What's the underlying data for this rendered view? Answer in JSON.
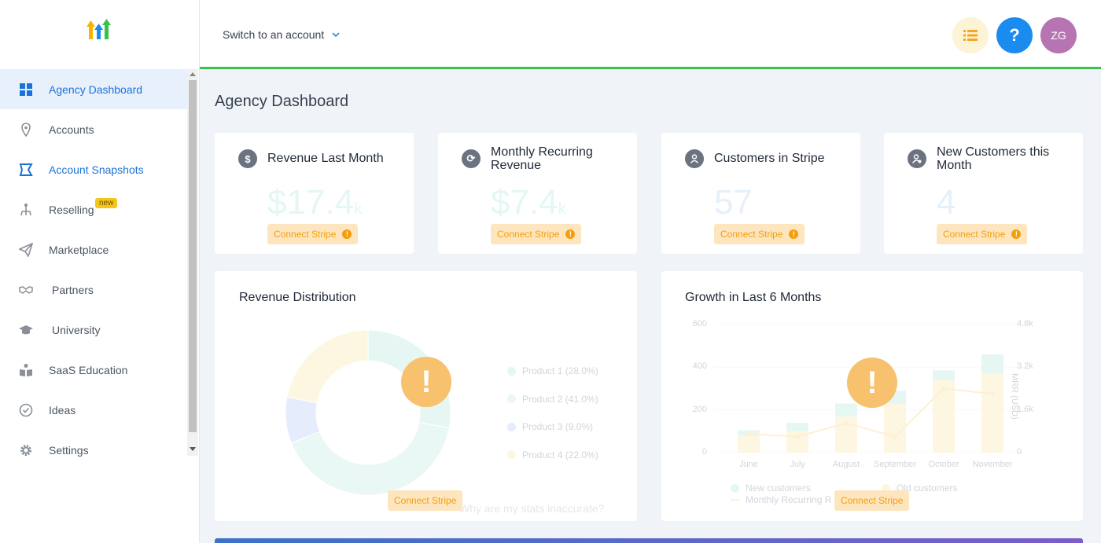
{
  "sidebar": {
    "items": [
      {
        "label": "Agency Dashboard",
        "icon": "dashboard-grid-icon"
      },
      {
        "label": "Accounts",
        "icon": "location-pin-icon"
      },
      {
        "label": "Account Snapshots",
        "icon": "snapshot-icon"
      },
      {
        "label": "Reselling",
        "icon": "reselling-icon",
        "badge": "new"
      },
      {
        "label": "Marketplace",
        "icon": "paper-plane-icon"
      },
      {
        "label": "Partners",
        "icon": "handshake-icon"
      },
      {
        "label": "University",
        "icon": "graduation-cap-icon"
      },
      {
        "label": "SaaS Education",
        "icon": "reader-icon"
      },
      {
        "label": "Ideas",
        "icon": "check-circle-icon"
      },
      {
        "label": "Settings",
        "icon": "gear-icon"
      }
    ]
  },
  "header": {
    "switch_account": "Switch to an account",
    "help": "?",
    "avatar_initials": "ZG"
  },
  "main": {
    "title": "Agency Dashboard",
    "stats": [
      {
        "title": "Revenue Last Month",
        "value": "$17.4",
        "unit": "k",
        "icon": "dollar-icon",
        "connect": "Connect Stripe"
      },
      {
        "title": "Monthly Recurring Revenue",
        "value": "$7.4",
        "unit": "k",
        "icon": "refresh-icon",
        "connect": "Connect Stripe"
      },
      {
        "title": "Customers in Stripe",
        "value": "57",
        "unit": "",
        "icon": "customers-icon",
        "connect": "Connect Stripe"
      },
      {
        "title": "New Customers this Month",
        "value": "4",
        "unit": "",
        "icon": "new-customer-icon",
        "connect": "Connect Stripe"
      }
    ],
    "revenue_distribution": {
      "title": "Revenue Distribution",
      "connect": "Connect Stripe",
      "link": "Why are my stats inaccurate?"
    },
    "growth": {
      "title": "Growth in Last 6 Months",
      "connect": "Connect Stripe",
      "legend": {
        "new": "New customers",
        "old": "Old customers",
        "mrr": "Monthly Recurring R"
      }
    }
  },
  "colors": {
    "accent": "#1a73d9",
    "header_border": "#37c24a",
    "connect_bg": "#fde6bf",
    "connect_text": "#f59e0b",
    "avatar": "#b774b3"
  },
  "chart_data": [
    {
      "type": "pie",
      "title": "Revenue Distribution",
      "categories": [
        "Product 1 (28.0%)",
        "Product 2 (41.0%)",
        "Product 3 (9.0%)",
        "Product 4 (22.0%)"
      ],
      "values": [
        28.0,
        41.0,
        9.0,
        22.0
      ],
      "colors": [
        "#e6f7f3",
        "#e9f8f4",
        "#e5ecfb",
        "#fdf6e1"
      ]
    },
    {
      "type": "bar",
      "title": "Growth in Last 6 Months",
      "categories": [
        "June",
        "July",
        "August",
        "September",
        "October",
        "November"
      ],
      "series": [
        {
          "name": "Old customers",
          "values": [
            80,
            100,
            170,
            230,
            340,
            370
          ]
        },
        {
          "name": "New customers",
          "values": [
            25,
            40,
            60,
            60,
            45,
            90
          ]
        },
        {
          "name": "Monthly Recurring R",
          "values": [
            700,
            600,
            1100,
            600,
            2400,
            2200
          ]
        }
      ],
      "ylim": [
        0,
        600
      ],
      "yticks": [
        "0",
        "200",
        "400",
        "600"
      ],
      "y2lim": [
        0,
        4800
      ],
      "y2ticks": [
        "0",
        "1.6k",
        "3.2k",
        "4.8k"
      ],
      "y2label": "MRR (USD)"
    }
  ]
}
